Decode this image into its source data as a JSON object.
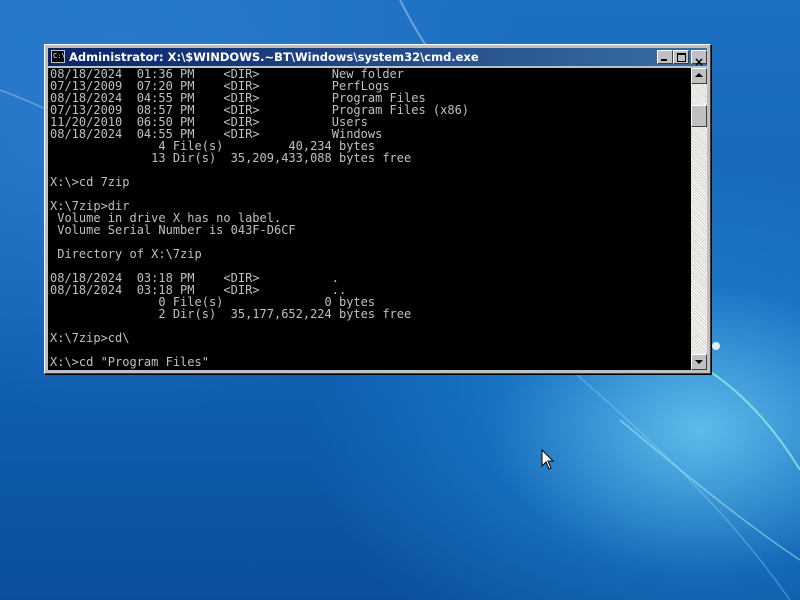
{
  "window": {
    "title": "Administrator: X:\\$WINDOWS.~BT\\Windows\\system32\\cmd.exe",
    "icon_text": "C:\\",
    "close_label": "×"
  },
  "console": {
    "lines": [
      "08/18/2024  01:36 PM    <DIR>          New folder",
      "07/13/2009  07:20 PM    <DIR>          PerfLogs",
      "08/18/2024  04:55 PM    <DIR>          Program Files",
      "07/13/2009  08:57 PM    <DIR>          Program Files (x86)",
      "11/20/2010  06:50 PM    <DIR>          Users",
      "08/18/2024  04:55 PM    <DIR>          Windows",
      "               4 File(s)         40,234 bytes",
      "              13 Dir(s)  35,209,433,088 bytes free",
      "",
      "X:\\>cd 7zip",
      "",
      "X:\\7zip>dir",
      " Volume in drive X has no label.",
      " Volume Serial Number is 043F-D6CF",
      "",
      " Directory of X:\\7zip",
      "",
      "08/18/2024  03:18 PM    <DIR>          .",
      "08/18/2024  03:18 PM    <DIR>          ..",
      "               0 File(s)              0 bytes",
      "               2 Dir(s)  35,177,652,224 bytes free",
      "",
      "X:\\7zip>cd\\",
      "",
      "X:\\>cd \"Program Files\""
    ]
  },
  "colors": {
    "console_bg": "#000000",
    "console_text": "#c0c0c0",
    "titlebar_start": "#0a246a",
    "titlebar_end": "#3a6ea5",
    "desktop": "#1868ba"
  },
  "icons": {
    "window_icon": "cmd-icon",
    "minimize": "minimize-icon",
    "maximize": "maximize-icon",
    "close": "close-icon",
    "scroll_up": "arrow-up-icon",
    "scroll_down": "arrow-down-icon",
    "pointer": "mouse-pointer-icon"
  }
}
